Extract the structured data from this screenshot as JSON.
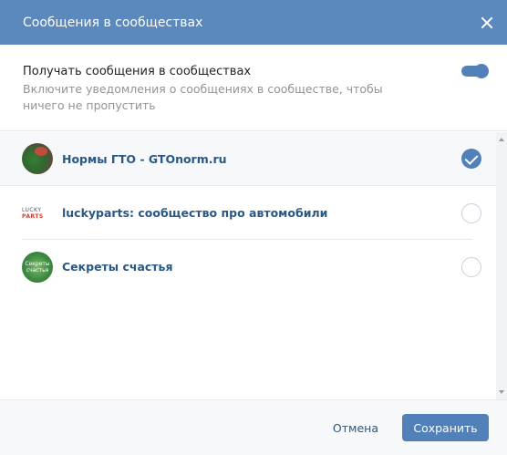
{
  "dialog": {
    "title": "Сообщения в сообществах"
  },
  "setting": {
    "label": "Получать сообщения в сообществах",
    "hint": "Включите уведомления о сообщениях в сообществе, чтобы ничего не пропустить",
    "enabled": true
  },
  "communities": [
    {
      "name": "Нормы ГТО - GTOnorm.ru",
      "selected": true,
      "avatar": "gto-avatar"
    },
    {
      "name": "luckyparts: сообщество про автомобили",
      "selected": false,
      "avatar": "luckyparts-avatar",
      "avatar_text": [
        "LUCKY",
        "PARTS"
      ]
    },
    {
      "name": "Секреты счастья",
      "selected": false,
      "avatar": "secrets-avatar",
      "avatar_text": [
        "Секреты",
        "счастья"
      ]
    }
  ],
  "footer": {
    "cancel_label": "Отмена",
    "save_label": "Сохранить"
  },
  "colors": {
    "header": "#5b88bd",
    "accent": "#5181b8",
    "link": "#2a5885"
  }
}
